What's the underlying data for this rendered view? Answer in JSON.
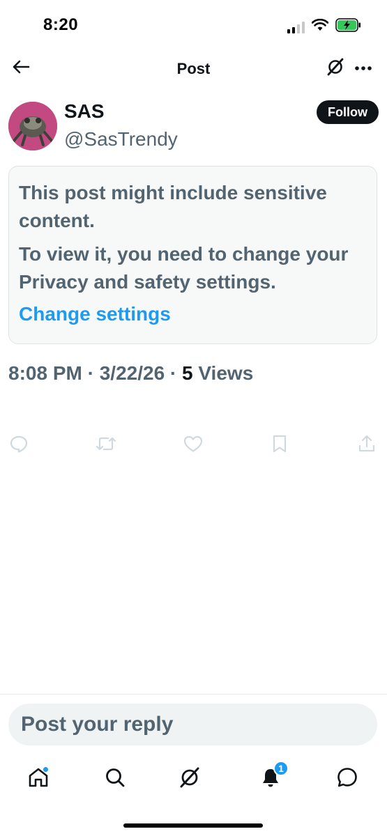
{
  "status_bar": {
    "time": "8:20",
    "signal_icon": "signal-icon",
    "wifi_icon": "wifi-icon",
    "battery_icon": "battery-charging-icon"
  },
  "header": {
    "title": "Post",
    "back_icon": "back-arrow-icon",
    "grok_icon": "grok-icon",
    "more_icon": "more-dots-icon"
  },
  "author": {
    "name": "SAS",
    "handle": "@SasTrendy",
    "follow_label": "Follow"
  },
  "notice": {
    "title": "This post might include sensitive content.",
    "body": "To view it, you need to change your Privacy and safety settings.",
    "link": "Change settings"
  },
  "meta": {
    "time": "8:08 PM",
    "separator": "·",
    "date": "3/22/26",
    "views_count": "5",
    "views_label": "Views"
  },
  "actions": [
    "reply-icon",
    "repost-icon",
    "like-icon",
    "bookmark-icon",
    "share-icon"
  ],
  "reply": {
    "placeholder": "Post your reply"
  },
  "tabbar": {
    "tabs": [
      "home-icon",
      "search-icon",
      "grok-icon",
      "notifications-icon",
      "messages-icon"
    ],
    "notifications_badge": "1"
  },
  "colors": {
    "accent": "#1d9bf0",
    "text_primary": "#0f1419",
    "text_secondary": "#536471"
  }
}
